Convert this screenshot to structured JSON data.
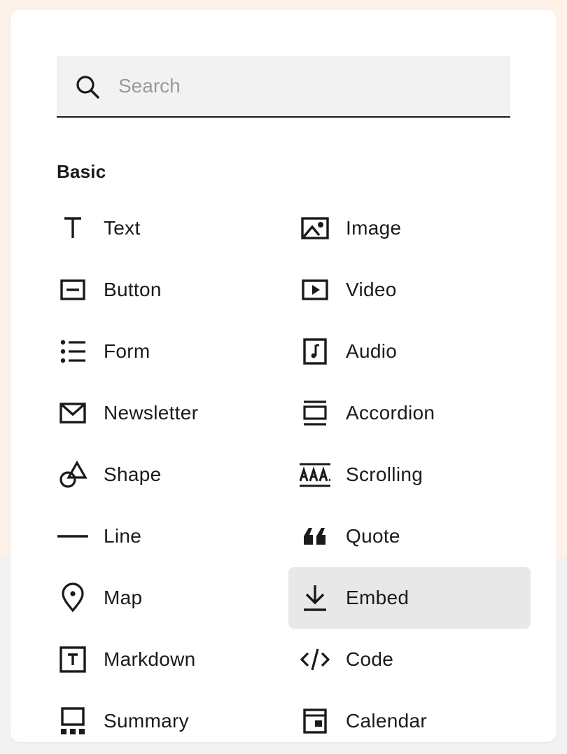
{
  "search": {
    "placeholder": "Search",
    "value": ""
  },
  "section": {
    "title": "Basic"
  },
  "items_left": [
    {
      "label": "Text",
      "icon": "text-icon"
    },
    {
      "label": "Button",
      "icon": "button-icon"
    },
    {
      "label": "Form",
      "icon": "form-icon"
    },
    {
      "label": "Newsletter",
      "icon": "newsletter-icon"
    },
    {
      "label": "Shape",
      "icon": "shape-icon"
    },
    {
      "label": "Line",
      "icon": "line-icon"
    },
    {
      "label": "Map",
      "icon": "map-pin-icon"
    },
    {
      "label": "Markdown",
      "icon": "markdown-icon"
    },
    {
      "label": "Summary",
      "icon": "summary-icon"
    }
  ],
  "items_right": [
    {
      "label": "Image",
      "icon": "image-icon"
    },
    {
      "label": "Video",
      "icon": "video-icon"
    },
    {
      "label": "Audio",
      "icon": "audio-icon"
    },
    {
      "label": "Accordion",
      "icon": "accordion-icon"
    },
    {
      "label": "Scrolling",
      "icon": "scrolling-icon"
    },
    {
      "label": "Quote",
      "icon": "quote-icon"
    },
    {
      "label": "Embed",
      "icon": "embed-icon",
      "selected": true
    },
    {
      "label": "Code",
      "icon": "code-icon"
    },
    {
      "label": "Calendar",
      "icon": "calendar-icon"
    }
  ],
  "colors": {
    "background_top": "#fdf1e8",
    "background_bottom": "#f2f2f2",
    "panel": "#ffffff",
    "search_bg": "#f2f2f2",
    "selected_bg": "#e8e8e8",
    "text": "#1a1a1a"
  }
}
